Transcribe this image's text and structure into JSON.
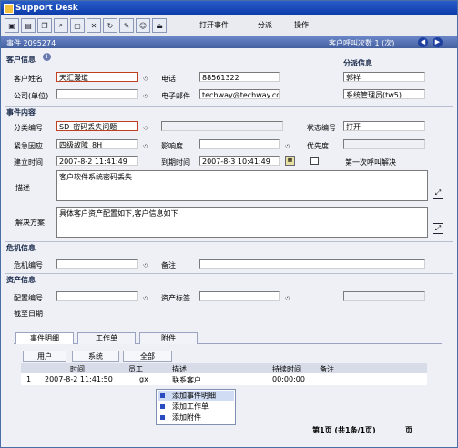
{
  "window": {
    "title": "Support Desk"
  },
  "menu": {
    "open_event": "打开事件",
    "assign": "分派",
    "action": "操作"
  },
  "header": {
    "event_label": "事件 2095274",
    "call_count": "客户呼叫次数 1 (次)"
  },
  "customer": {
    "section": "客户信息",
    "name_label": "客户姓名",
    "name_value": "天汇漫道",
    "phone_label": "电话",
    "phone_value": "88561322",
    "company_label": "公司(单位)",
    "company_value": "",
    "email_label": "电子邮件",
    "email_value": "techway@techway.com"
  },
  "assign_info": {
    "section": "分派信息",
    "person": "郭祥",
    "group": "系统管理员(tw5)"
  },
  "event": {
    "section": "事件内容",
    "category_label": "分类编号",
    "category_value": "SD_密码丢失问题",
    "status_label": "状态编号",
    "status_value": "打开",
    "urgency_label": "紧急因应",
    "urgency_value": "四级故障_8H",
    "impact_label": "影响度",
    "impact_value": "",
    "priority_label": "优先度",
    "priority_value": "",
    "created_label": "建立时间",
    "created_value": "2007-8-2 11:41:49",
    "due_label": "到期时间",
    "due_value": "2007-8-3 10:41:49",
    "first_call_label": "第一次呼叫解决",
    "desc_label": "描述",
    "desc_value": "客户软件系统密码丢失",
    "solution_label": "解决方案",
    "solution_value": "具体客户资产配置如下,客户信息如下"
  },
  "crisis": {
    "section": "危机信息",
    "no_label": "危机编号",
    "note_label": "备注"
  },
  "asset": {
    "section": "资产信息",
    "config_label": "配置编号",
    "tag_label": "资产标签",
    "expire_label": "截至日期"
  },
  "tabs": [
    "事件明细",
    "工作单",
    "附件"
  ],
  "subtabs": [
    "用户",
    "系统",
    "全部"
  ],
  "grid": {
    "columns": [
      "时间",
      "员工",
      "描述",
      "持续时间",
      "备注"
    ],
    "rows": [
      {
        "no": "1",
        "time": "2007-8-2 11:41:50",
        "staff": "gx",
        "desc": "联系客户",
        "duration": "00:00:00",
        "note": ""
      }
    ]
  },
  "context_menu": [
    "添加事件明细",
    "添加工作单",
    "添加附件"
  ],
  "pager": {
    "text": "第1页 (共1条/1页)",
    "suffix": "页"
  }
}
